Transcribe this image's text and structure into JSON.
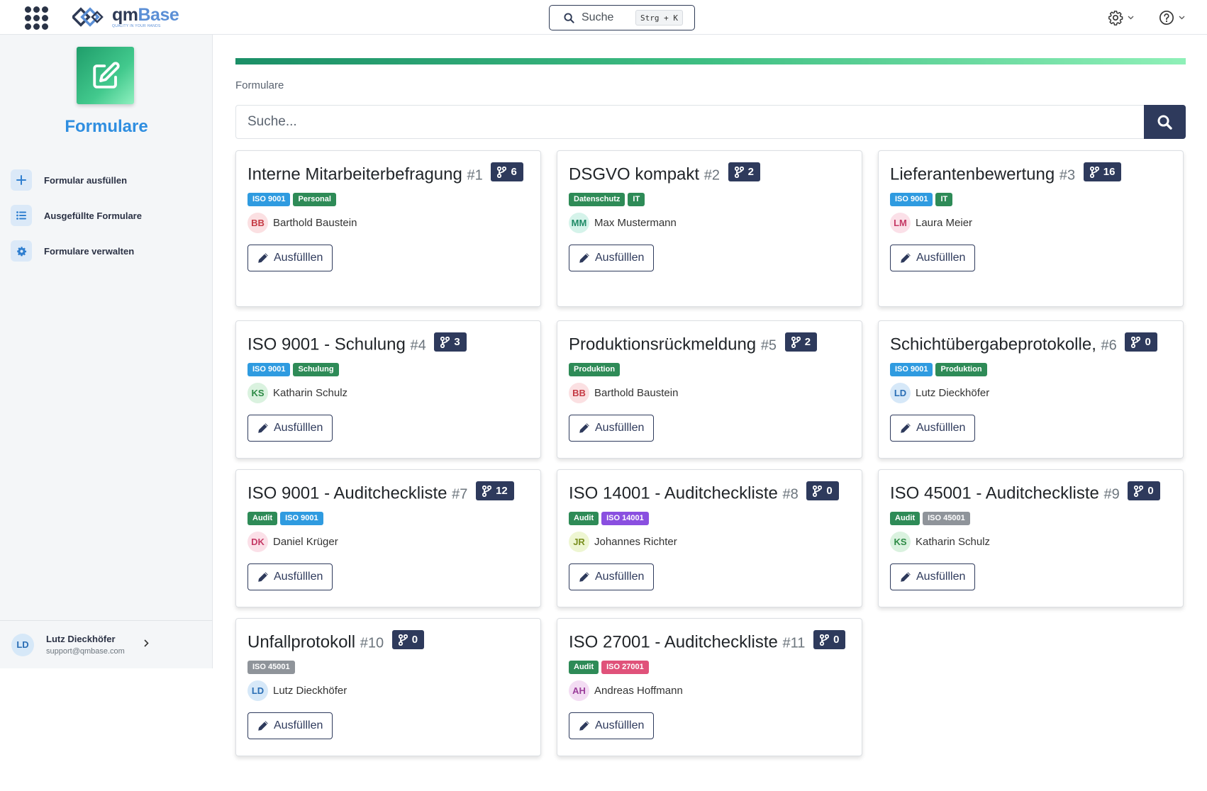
{
  "header": {
    "logo": {
      "name_part1": "qm",
      "name_part2": "Base",
      "tagline": "QUALITY IN YOUR HANDS"
    },
    "search": {
      "label": "Suche",
      "shortcut": "Strg + K"
    }
  },
  "sidebar": {
    "title": "Formulare",
    "items": [
      {
        "label": "Formular ausfüllen",
        "icon": "plus-icon"
      },
      {
        "label": "Ausgefüllte Formulare",
        "icon": "list-icon"
      },
      {
        "label": "Formulare verwalten",
        "icon": "gear-icon"
      }
    ],
    "user": {
      "initials": "LD",
      "name": "Lutz Dieckhöfer",
      "email": "support@qmbase.com"
    }
  },
  "main": {
    "progress_percent": 100,
    "breadcrumb": "Formulare",
    "search_placeholder": "Suche...",
    "fill_label": "Ausfülllen"
  },
  "colors": {
    "navy": "#2e3a5c",
    "tag_iso9001": "#2f9be0",
    "tag_green": "#2e8b57",
    "tag_iso14001": "#8a4fe0",
    "tag_iso45001": "#8f949a",
    "tag_iso27001": "#e0527a"
  },
  "cards": [
    {
      "title": "Interne Mitarbeiterbefragung",
      "num": "#1",
      "versions": "6",
      "tags": [
        {
          "text": "ISO 9001",
          "color": "#2f9be0"
        },
        {
          "text": "Personal",
          "color": "#2e8b57"
        }
      ],
      "person": {
        "initials": "BB",
        "name": "Barthold Baustein",
        "bg": "#fbe0e2",
        "fg": "#c53a44"
      }
    },
    {
      "title": "DSGVO kompakt",
      "num": "#2",
      "versions": "2",
      "tags": [
        {
          "text": "Datenschutz",
          "color": "#2e8b57"
        },
        {
          "text": "IT",
          "color": "#2e8b57"
        }
      ],
      "person": {
        "initials": "MM",
        "name": "Max Mustermann",
        "bg": "#d5f3ea",
        "fg": "#1f8a66"
      }
    },
    {
      "title": "Lieferantenbewertung",
      "num": "#3",
      "versions": "16",
      "tags": [
        {
          "text": "ISO 9001",
          "color": "#2f9be0"
        },
        {
          "text": "IT",
          "color": "#2e8b57"
        }
      ],
      "person": {
        "initials": "LM",
        "name": "Laura Meier",
        "bg": "#fbe0e8",
        "fg": "#c53a66"
      }
    },
    {
      "title": "ISO 9001 - Schulung",
      "num": "#4",
      "versions": "3",
      "tags": [
        {
          "text": "ISO 9001",
          "color": "#2f9be0"
        },
        {
          "text": "Schulung",
          "color": "#2e8b57"
        }
      ],
      "person": {
        "initials": "KS",
        "name": "Katharin Schulz",
        "bg": "#daf2df",
        "fg": "#2d8a45"
      }
    },
    {
      "title": "Produktionsrückmeldung",
      "num": "#5",
      "versions": "2",
      "tags": [
        {
          "text": "Produktion",
          "color": "#2e8b57"
        }
      ],
      "person": {
        "initials": "BB",
        "name": "Barthold Baustein",
        "bg": "#fbe0e2",
        "fg": "#c53a44"
      }
    },
    {
      "title": "Schichtübergabeprotokolle,",
      "num": "#6",
      "versions": "0",
      "tags": [
        {
          "text": "ISO 9001",
          "color": "#2f9be0"
        },
        {
          "text": "Produktion",
          "color": "#2e8b57"
        }
      ],
      "person": {
        "initials": "LD",
        "name": "Lutz Dieckhöfer",
        "bg": "#d6e8f8",
        "fg": "#2a6eb5"
      }
    },
    {
      "title": "ISO 9001 - Auditcheckliste",
      "num": "#7",
      "versions": "12",
      "tags": [
        {
          "text": "Audit",
          "color": "#2e8b57"
        },
        {
          "text": "ISO 9001",
          "color": "#2f9be0"
        }
      ],
      "person": {
        "initials": "DK",
        "name": "Daniel Krüger",
        "bg": "#fbe0e8",
        "fg": "#c53a66"
      }
    },
    {
      "title": "ISO 14001 - Auditcheckliste",
      "num": "#8",
      "versions": "0",
      "tags": [
        {
          "text": "Audit",
          "color": "#2e8b57"
        },
        {
          "text": "ISO 14001",
          "color": "#8a4fe0"
        }
      ],
      "person": {
        "initials": "JR",
        "name": "Johannes Richter",
        "bg": "#eef6d2",
        "fg": "#7a8f1f"
      }
    },
    {
      "title": "ISO 45001 - Auditcheckliste",
      "num": "#9",
      "versions": "0",
      "tags": [
        {
          "text": "Audit",
          "color": "#2e8b57"
        },
        {
          "text": "ISO 45001",
          "color": "#8f949a"
        }
      ],
      "person": {
        "initials": "KS",
        "name": "Katharin Schulz",
        "bg": "#daf2df",
        "fg": "#2d8a45"
      }
    },
    {
      "title": "Unfallprotokoll",
      "num": "#10",
      "versions": "0",
      "tags": [
        {
          "text": "ISO 45001",
          "color": "#8f949a"
        }
      ],
      "person": {
        "initials": "LD",
        "name": "Lutz Dieckhöfer",
        "bg": "#d6e8f8",
        "fg": "#2a6eb5"
      }
    },
    {
      "title": "ISO 27001 - Auditcheckliste",
      "num": "#11",
      "versions": "0",
      "tags": [
        {
          "text": "Audit",
          "color": "#2e8b57"
        },
        {
          "text": "ISO 27001",
          "color": "#e0527a"
        }
      ],
      "person": {
        "initials": "AH",
        "name": "Andreas Hoffmann",
        "bg": "#f3dcf3",
        "fg": "#9a3d9a"
      }
    }
  ]
}
